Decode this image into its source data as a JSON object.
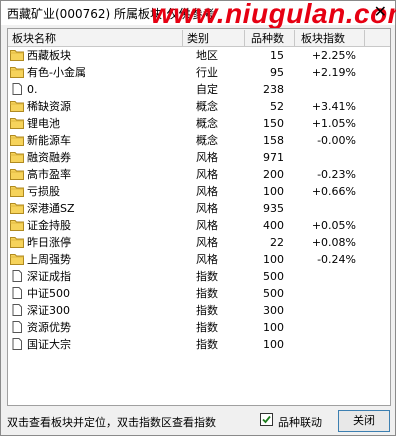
{
  "window": {
    "title": "西藏矿业(000762)  所属板块(仅供参考",
    "watermark": "www.niugulan.com"
  },
  "table": {
    "columns": [
      "板块名称",
      "类别",
      "品种数",
      "板块指数"
    ],
    "rows": [
      {
        "name": "西藏板块",
        "type": "地区",
        "count": "15",
        "index": "+2.25%",
        "icon": "folder-icon"
      },
      {
        "name": "有色-小金属",
        "type": "行业",
        "count": "95",
        "index": "+2.19%",
        "icon": "folder-icon"
      },
      {
        "name": "0.",
        "type": "自定",
        "count": "238",
        "index": "",
        "icon": "document-icon"
      },
      {
        "name": "稀缺资源",
        "type": "概念",
        "count": "52",
        "index": "+3.41%",
        "icon": "folder-icon"
      },
      {
        "name": "锂电池",
        "type": "概念",
        "count": "150",
        "index": "+1.05%",
        "icon": "folder-icon"
      },
      {
        "name": "新能源车",
        "type": "概念",
        "count": "158",
        "index": "-0.00%",
        "icon": "folder-icon"
      },
      {
        "name": "融资融券",
        "type": "风格",
        "count": "971",
        "index": "",
        "icon": "folder-icon"
      },
      {
        "name": "高市盈率",
        "type": "风格",
        "count": "200",
        "index": "-0.23%",
        "icon": "folder-icon"
      },
      {
        "name": "亏损股",
        "type": "风格",
        "count": "100",
        "index": "+0.66%",
        "icon": "folder-icon"
      },
      {
        "name": "深港通SZ",
        "type": "风格",
        "count": "935",
        "index": "",
        "icon": "folder-icon"
      },
      {
        "name": "证金持股",
        "type": "风格",
        "count": "400",
        "index": "+0.05%",
        "icon": "folder-icon"
      },
      {
        "name": "昨日涨停",
        "type": "风格",
        "count": "22",
        "index": "+0.08%",
        "icon": "folder-icon"
      },
      {
        "name": "上周强势",
        "type": "风格",
        "count": "100",
        "index": "-0.24%",
        "icon": "folder-icon"
      },
      {
        "name": "深证成指",
        "type": "指数",
        "count": "500",
        "index": "",
        "icon": "document-icon"
      },
      {
        "name": "中证500",
        "type": "指数",
        "count": "500",
        "index": "",
        "icon": "document-icon"
      },
      {
        "name": "深证300",
        "type": "指数",
        "count": "300",
        "index": "",
        "icon": "document-icon"
      },
      {
        "name": "资源优势",
        "type": "指数",
        "count": "100",
        "index": "",
        "icon": "document-icon"
      },
      {
        "name": "国证大宗",
        "type": "指数",
        "count": "100",
        "index": "",
        "icon": "document-icon"
      }
    ]
  },
  "footer": {
    "hint": "双击查看板块并定位，双击指数区查看指数",
    "checkbox_label": "品种联动",
    "checkbox_checked": true,
    "close_label": "关闭"
  }
}
